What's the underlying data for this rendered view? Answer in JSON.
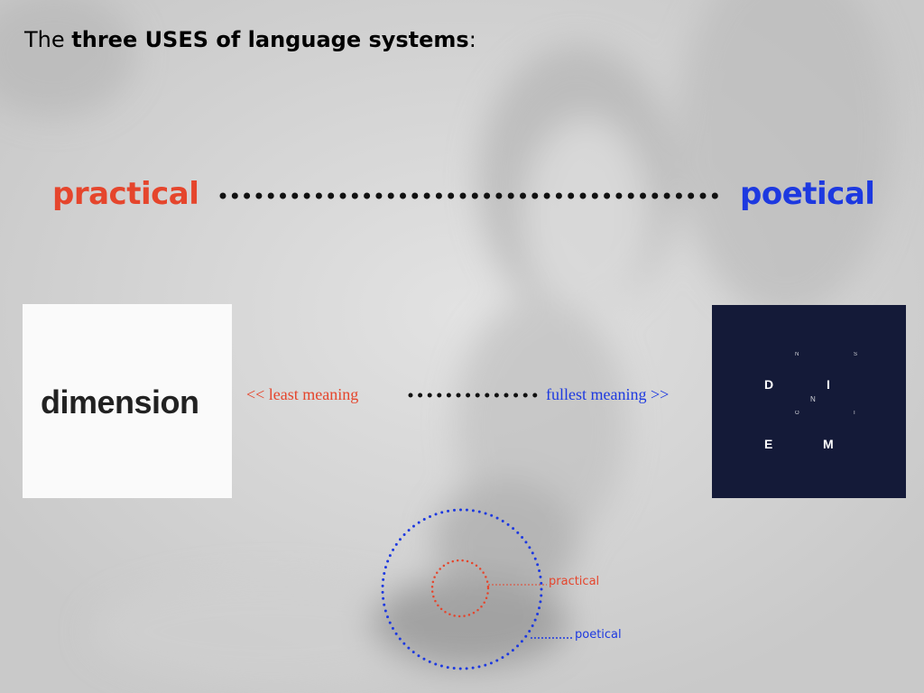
{
  "title": {
    "prefix": "The ",
    "bold": "three USES of language systems",
    "suffix": ":"
  },
  "scale": {
    "left_label": "practical",
    "right_label": "poetical"
  },
  "meaning": {
    "left_label": "<< least meaning",
    "right_label": "fullest meaning >>"
  },
  "examples": {
    "practical_word": "dimension",
    "poetical_letters": [
      "D",
      "I",
      "N",
      "E",
      "M"
    ],
    "poetical_small_letters": [
      "N",
      "S",
      "O",
      "I"
    ]
  },
  "diagram": {
    "inner_label": "practical",
    "outer_label": "poetical"
  },
  "colors": {
    "practical": "#e5452c",
    "poetical": "#1d39e0",
    "dark_card": "#141a38"
  }
}
